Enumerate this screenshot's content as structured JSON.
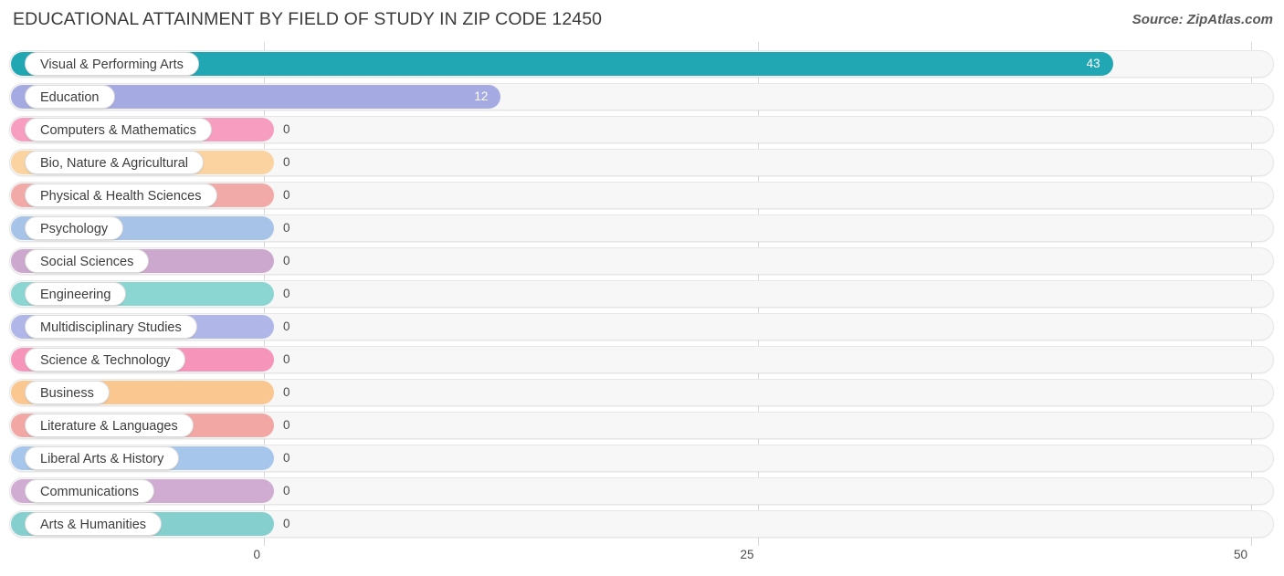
{
  "header": {
    "title": "EDUCATIONAL ATTAINMENT BY FIELD OF STUDY IN ZIP CODE 12450",
    "source": "Source: ZipAtlas.com"
  },
  "chart_data": {
    "type": "bar",
    "orientation": "horizontal",
    "title": "EDUCATIONAL ATTAINMENT BY FIELD OF STUDY IN ZIP CODE 12450",
    "xlabel": "",
    "ylabel": "",
    "xlim": [
      0,
      50
    ],
    "xticks": [
      0,
      25,
      50
    ],
    "xtick_labels": [
      "0",
      "25",
      "50"
    ],
    "grid": true,
    "legend": false,
    "categories": [
      "Visual & Performing Arts",
      "Education",
      "Computers & Mathematics",
      "Bio, Nature & Agricultural",
      "Physical & Health Sciences",
      "Psychology",
      "Social Sciences",
      "Engineering",
      "Multidisciplinary Studies",
      "Science & Technology",
      "Business",
      "Literature & Languages",
      "Liberal Arts & History",
      "Communications",
      "Arts & Humanities"
    ],
    "values": [
      43,
      12,
      0,
      0,
      0,
      0,
      0,
      0,
      0,
      0,
      0,
      0,
      0,
      0,
      0
    ],
    "value_labels": [
      "43",
      "12",
      "0",
      "0",
      "0",
      "0",
      "0",
      "0",
      "0",
      "0",
      "0",
      "0",
      "0",
      "0",
      "0"
    ],
    "colors": [
      "#21a6b4",
      "#a6aae2",
      "#f79ec0",
      "#fbd3a0",
      "#f2aaa8",
      "#a7c4e8",
      "#cda8ce",
      "#8bd5d3",
      "#b0b6e8",
      "#f694ba",
      "#fbc790",
      "#f2a7a4",
      "#a6c6ec",
      "#d0abd2",
      "#85cfcf"
    ]
  }
}
